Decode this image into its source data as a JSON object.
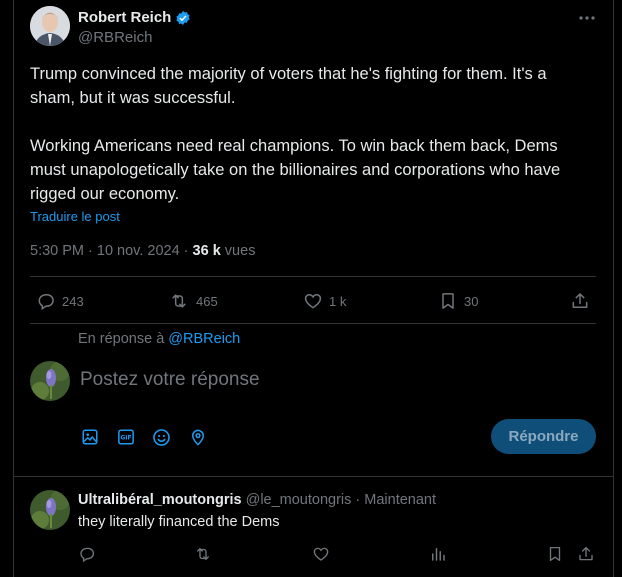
{
  "post": {
    "author_name": "Robert Reich",
    "handle": "@RBReich",
    "text_p1": "Trump convinced the majority of voters that he's fighting for them. It's a sham, but it was successful.",
    "text_p2": "Working Americans need real champions. To win back them back, Dems must unapologetically take on the billionaires and corporations who have rigged our economy.",
    "translate": "Traduire le post",
    "time": "5:30 PM · 10 nov. 2024 · ",
    "views_count": "36 k",
    "views_label": " vues",
    "replies": "243",
    "reposts": "465",
    "likes": "1 k",
    "bookmarks": "30"
  },
  "composer": {
    "reply_to_prefix": "En réponse à ",
    "reply_to_handle": "@RBReich",
    "placeholder": "Postez votre réponse",
    "submit_label": "Répondre"
  },
  "reply": {
    "author_name": "Ultralibéral_moutongris",
    "meta": "@le_moutongris · Maintenant",
    "text": "they literally financed the Dems"
  },
  "colors": {
    "accent": "#1d9bf0",
    "border": "#2f3336",
    "muted": "#71767b",
    "button": "#0f4e78"
  }
}
